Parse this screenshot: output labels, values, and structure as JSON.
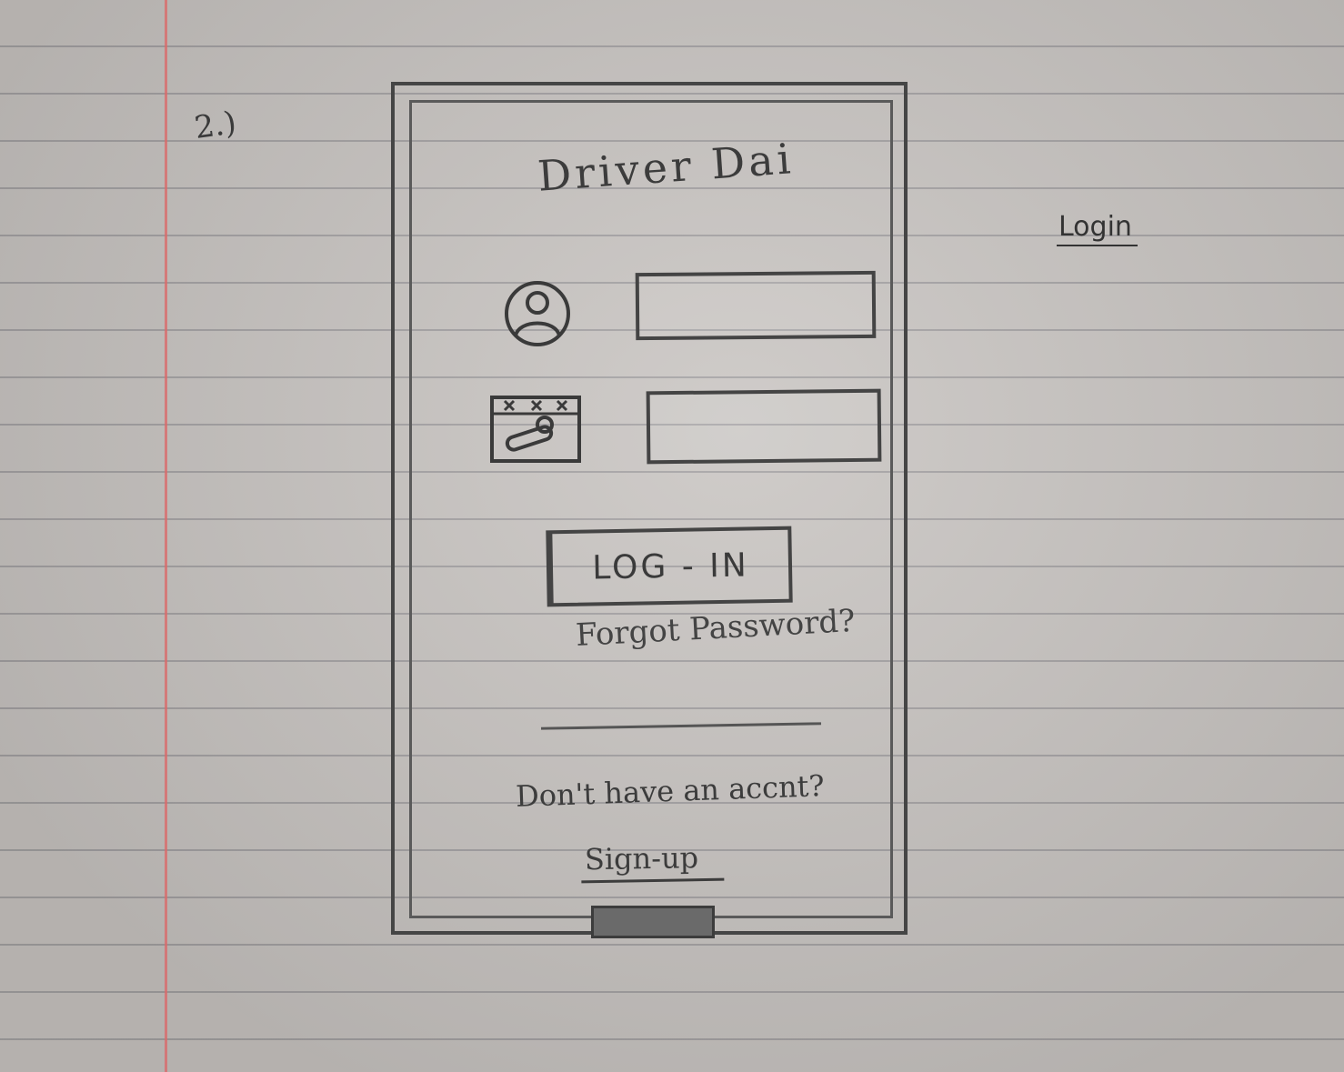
{
  "sheet": {
    "number": "2.)",
    "caption": "Login"
  },
  "app": {
    "title": "Driver Dai"
  },
  "form": {
    "username_value": "",
    "password_value": "",
    "login_label": "LOG - IN",
    "forgot_label": "Forgot Password?"
  },
  "footer": {
    "prompt": "Don't have an accnt?",
    "signup_label": "Sign-up"
  },
  "icons": {
    "username": "user-icon",
    "password": "key-card-icon"
  }
}
